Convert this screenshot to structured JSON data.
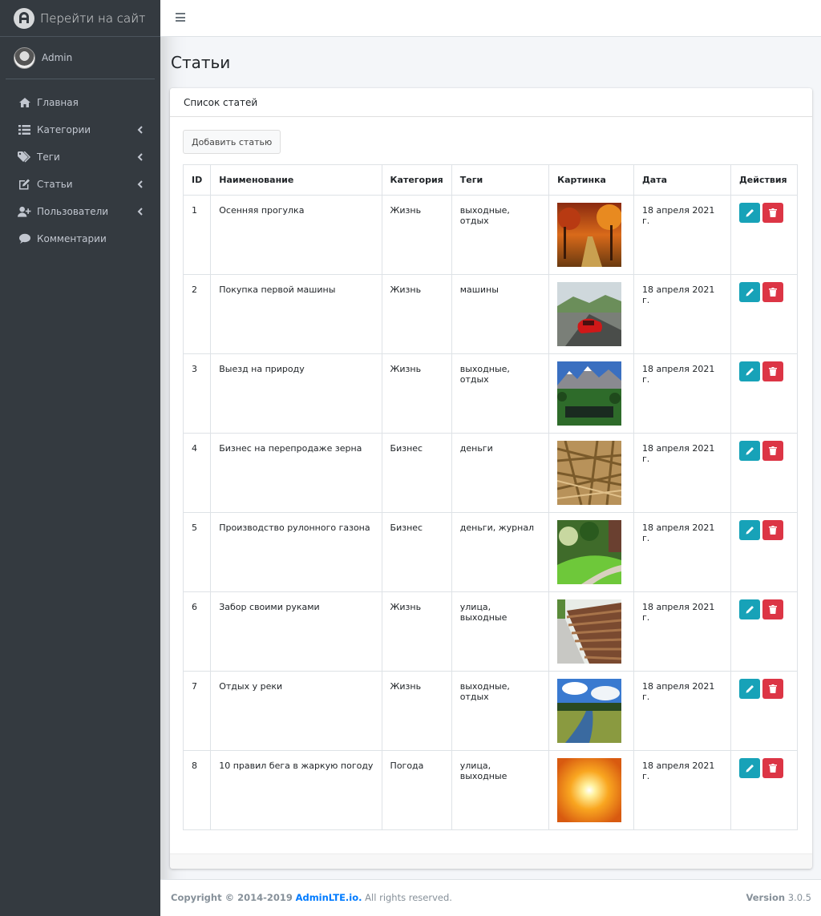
{
  "brand": {
    "title": "Перейти на сайт"
  },
  "user": {
    "name": "Admin"
  },
  "sidebar": {
    "items": [
      {
        "label": "Главная",
        "icon": "home-icon"
      },
      {
        "label": "Категории",
        "icon": "list-icon"
      },
      {
        "label": "Теги",
        "icon": "tags-icon"
      },
      {
        "label": "Статьи",
        "icon": "edit-icon"
      },
      {
        "label": "Пользователи",
        "icon": "user-plus-icon"
      },
      {
        "label": "Комментарии",
        "icon": "comment-icon"
      }
    ]
  },
  "page": {
    "title": "Статьи"
  },
  "card": {
    "title": "Список статей",
    "add_label": "Добавить статью"
  },
  "table": {
    "headers": [
      "ID",
      "Наименование",
      "Категория",
      "Теги",
      "Картинка",
      "Дата",
      "Действия"
    ],
    "rows": [
      {
        "id": "1",
        "name": "Осенняя прогулка",
        "category": "Жизнь",
        "tags": "выходные, отдых",
        "date": "18 апреля 2021 г."
      },
      {
        "id": "2",
        "name": "Покупка первой машины",
        "category": "Жизнь",
        "tags": "машины",
        "date": "18 апреля 2021 г."
      },
      {
        "id": "3",
        "name": "Выезд на природу",
        "category": "Жизнь",
        "tags": "выходные, отдых",
        "date": "18 апреля 2021 г."
      },
      {
        "id": "4",
        "name": "Бизнес на перепродаже зерна",
        "category": "Бизнес",
        "tags": "деньги",
        "date": "18 апреля 2021 г."
      },
      {
        "id": "5",
        "name": "Производство рулонного газона",
        "category": "Бизнес",
        "tags": "деньги, журнал",
        "date": "18 апреля 2021 г."
      },
      {
        "id": "6",
        "name": "Забор своими руками",
        "category": "Жизнь",
        "tags": "улица, выходные",
        "date": "18 апреля 2021 г."
      },
      {
        "id": "7",
        "name": "Отдых у реки",
        "category": "Жизнь",
        "tags": "выходные, отдых",
        "date": "18 апреля 2021 г."
      },
      {
        "id": "8",
        "name": "10 правил бега в жаркую погоду",
        "category": "Погода",
        "tags": "улица, выходные",
        "date": "18 апреля 2021 г."
      }
    ]
  },
  "footer": {
    "copyright": "Copyright © 2014-2019",
    "link": "AdminLTE.io.",
    "rights": "All rights reserved.",
    "version_label": "Version",
    "version": "3.0.5"
  },
  "colors": {
    "sidebar": "#343a40",
    "info": "#17a2b8",
    "danger": "#dc3545",
    "link": "#007bff"
  }
}
